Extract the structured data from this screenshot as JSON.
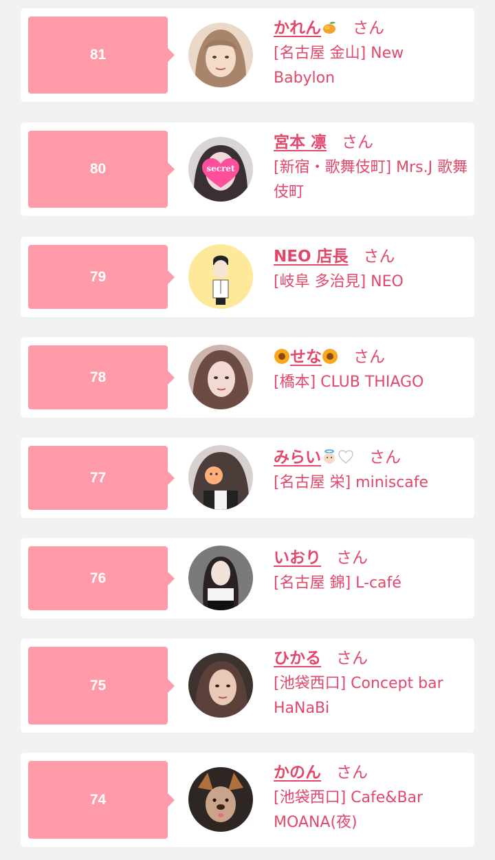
{
  "colors": {
    "accent": "#e2476a",
    "rank_bg": "#ff9aa9",
    "page_bg": "#f1f1f1",
    "card_bg": "#ffffff"
  },
  "entries": [
    {
      "rank": "81",
      "name": "かれん",
      "name_suffix_icon": "mango-icon",
      "honorific": "さん",
      "shop": "[名古屋 金山] New Babylon",
      "avatar": "photo-woman-light-hair"
    },
    {
      "rank": "80",
      "name": "宮本 凛",
      "honorific": "さん",
      "shop": "[新宿・歌舞伎町] Mrs.J 歌舞伎町",
      "avatar": "photo-secret-heart",
      "avatar_text": "secret"
    },
    {
      "rank": "79",
      "name": "NEO 店長",
      "honorific": "さん",
      "shop": "[岐阜 多治見] NEO",
      "avatar": "illustration-man-yellow"
    },
    {
      "rank": "78",
      "name": "せな",
      "name_prefix_icon": "sunflower-icon",
      "name_suffix_icon": "sunflower-icon",
      "honorific": "さん",
      "shop": "[橋本] CLUB THIAGO",
      "avatar": "photo-woman-brown-hair"
    },
    {
      "rank": "77",
      "name": "みらい",
      "name_suffix_icon": "angel-face-white-heart-icons",
      "honorific": "さん",
      "shop": "[名古屋 栄] miniscafe",
      "avatar": "photo-woman-emoji-face"
    },
    {
      "rank": "76",
      "name": "いおり",
      "honorific": "さん",
      "shop": "[名古屋 錦] L-café",
      "avatar": "photo-woman-dark-hair"
    },
    {
      "rank": "75",
      "name": "ひかる",
      "honorific": "さん",
      "shop": "[池袋西口] Concept bar HaNaBi",
      "avatar": "photo-woman-dark-tone"
    },
    {
      "rank": "74",
      "name": "かのん",
      "honorific": "さん",
      "shop": "[池袋西口] Cafe&Bar MOANA(夜)",
      "avatar": "photo-dog-filter"
    }
  ]
}
